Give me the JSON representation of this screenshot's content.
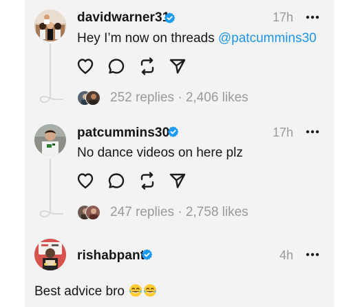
{
  "posts": [
    {
      "username": "davidwarner31",
      "timestamp": "17h",
      "text": "Hey I’m now on threads",
      "mention": "@patcummins30",
      "verified_icon": "verified-badge-icon",
      "more_icon": "more-options-icon",
      "actions": [
        "like-icon",
        "reply-icon",
        "repost-icon",
        "share-icon"
      ],
      "stats": "252 replies · 2,406 likes"
    },
    {
      "username": "patcummins30",
      "timestamp": "17h",
      "text": "No dance videos on here plz",
      "verified_icon": "verified-badge-icon",
      "more_icon": "more-options-icon",
      "actions": [
        "like-icon",
        "reply-icon",
        "repost-icon",
        "share-icon"
      ],
      "stats": "247 replies · 2,758 likes"
    },
    {
      "username": "rishabpant",
      "timestamp": "4h",
      "text": "Best advice bro",
      "emoji": [
        "laughing-tears-emoji",
        "laughing-tears-emoji"
      ],
      "verified_icon": "verified-badge-icon",
      "more_icon": "more-options-icon"
    }
  ],
  "colors": {
    "panel_background": "#f3f3f3",
    "mention": "#1e94e8",
    "verified": "#1d9bf0",
    "muted_text": "#9a9a9a",
    "primary_text": "#161616"
  }
}
